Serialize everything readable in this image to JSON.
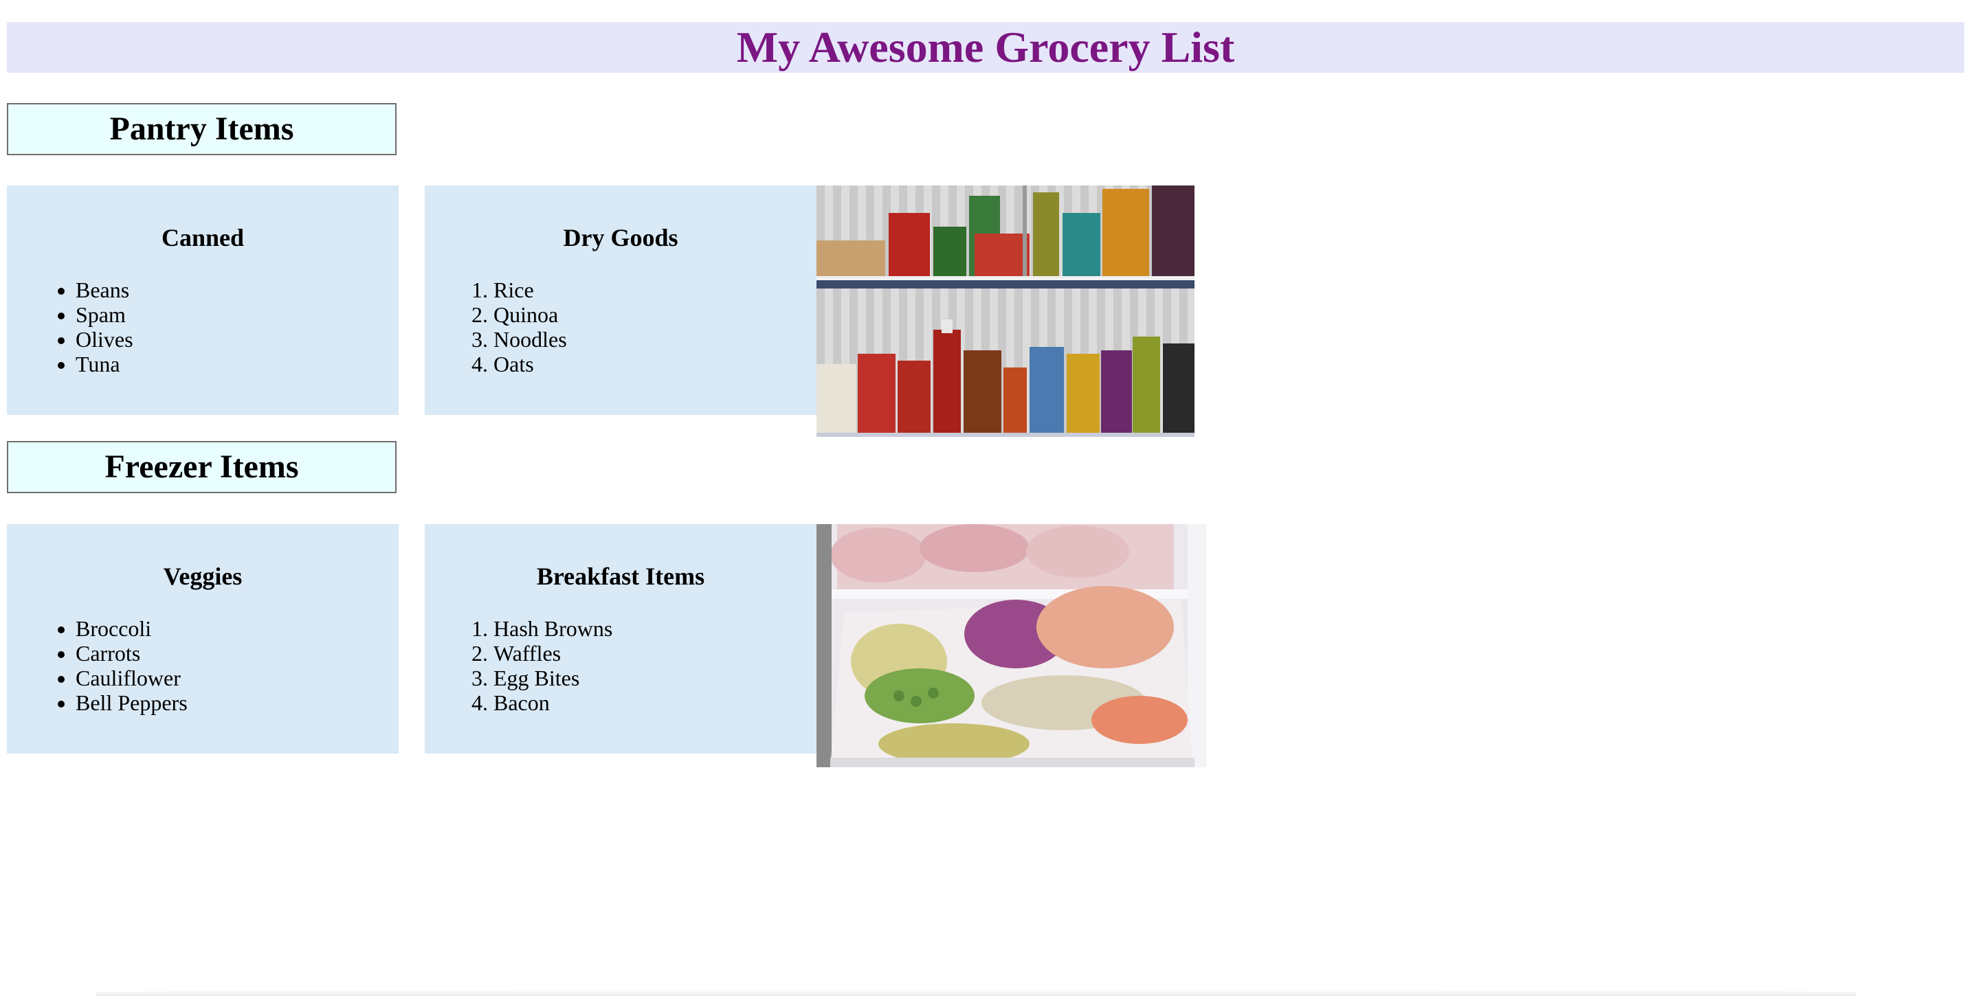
{
  "page": {
    "title": "My Awesome Grocery List"
  },
  "pantry": {
    "heading": "Pantry Items",
    "canned": {
      "title": "Canned",
      "items": [
        "Beans",
        "Spam",
        "Olives",
        "Tuna"
      ]
    },
    "dry_goods": {
      "title": "Dry Goods",
      "items": [
        "Rice",
        "Quinoa",
        "Noodles",
        "Oats"
      ]
    },
    "image_alt": "pantry shelves photo"
  },
  "freezer": {
    "heading": "Freezer Items",
    "veggies": {
      "title": "Veggies",
      "items": [
        "Broccoli",
        "Carrots",
        "Cauliflower",
        "Bell Peppers"
      ]
    },
    "breakfast": {
      "title": "Breakfast Items",
      "items": [
        "Hash Browns",
        "Waffles",
        "Egg Bites",
        "Bacon"
      ]
    },
    "image_alt": "freezer drawer photo"
  },
  "colors": {
    "title_text": "#7b1682",
    "title_background": "#e6e6fa",
    "section_heading_background": "#e9fefe",
    "card_background": "#d9e9f5"
  }
}
